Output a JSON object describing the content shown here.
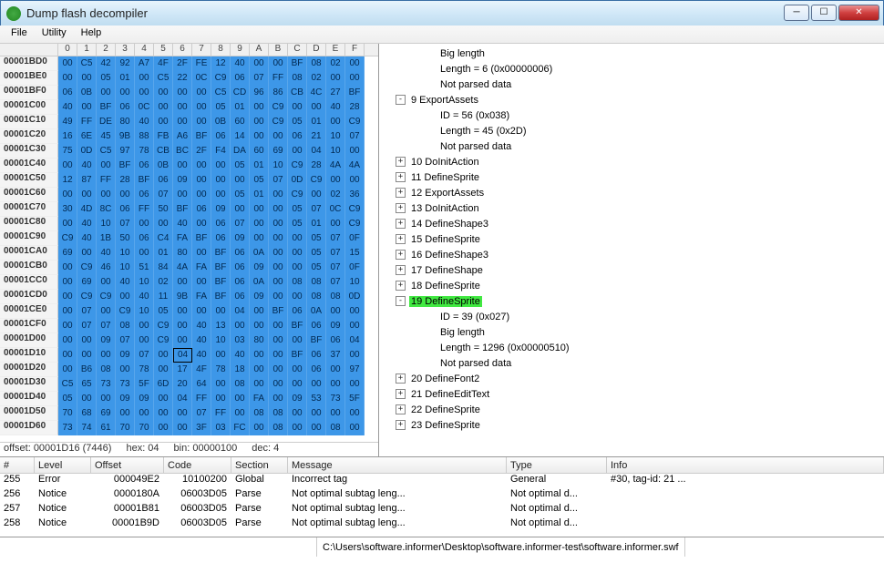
{
  "window": {
    "title": "Dump flash decompiler"
  },
  "menu": [
    "File",
    "Utility",
    "Help"
  ],
  "hex": {
    "cols": [
      "0",
      "1",
      "2",
      "3",
      "4",
      "5",
      "6",
      "7",
      "8",
      "9",
      "A",
      "B",
      "C",
      "D",
      "E",
      "F"
    ],
    "rows": [
      {
        "addr": "00001BD0",
        "b": [
          "00",
          "C5",
          "42",
          "92",
          "A7",
          "4F",
          "2F",
          "FE",
          "12",
          "40",
          "00",
          "00",
          "BF",
          "08",
          "02",
          "00"
        ]
      },
      {
        "addr": "00001BE0",
        "b": [
          "00",
          "00",
          "05",
          "01",
          "00",
          "C5",
          "22",
          "0C",
          "C9",
          "06",
          "07",
          "FF",
          "08",
          "02",
          "00",
          "00"
        ]
      },
      {
        "addr": "00001BF0",
        "b": [
          "06",
          "0B",
          "00",
          "00",
          "00",
          "00",
          "00",
          "00",
          "C5",
          "CD",
          "96",
          "86",
          "CB",
          "4C",
          "27",
          "BF"
        ]
      },
      {
        "addr": "00001C00",
        "b": [
          "40",
          "00",
          "BF",
          "06",
          "0C",
          "00",
          "00",
          "00",
          "05",
          "01",
          "00",
          "C9",
          "00",
          "00",
          "40",
          "28"
        ]
      },
      {
        "addr": "00001C10",
        "b": [
          "49",
          "FF",
          "DE",
          "80",
          "40",
          "00",
          "00",
          "00",
          "0B",
          "60",
          "00",
          "C9",
          "05",
          "01",
          "00",
          "C9"
        ]
      },
      {
        "addr": "00001C20",
        "b": [
          "16",
          "6E",
          "45",
          "9B",
          "88",
          "FB",
          "A6",
          "BF",
          "06",
          "14",
          "00",
          "00",
          "06",
          "21",
          "10",
          "07"
        ]
      },
      {
        "addr": "00001C30",
        "b": [
          "75",
          "0D",
          "C5",
          "97",
          "78",
          "CB",
          "BC",
          "2F",
          "F4",
          "DA",
          "60",
          "69",
          "00",
          "04",
          "10",
          "00"
        ]
      },
      {
        "addr": "00001C40",
        "b": [
          "00",
          "40",
          "00",
          "BF",
          "06",
          "0B",
          "00",
          "00",
          "00",
          "05",
          "01",
          "10",
          "C9",
          "28",
          "4A",
          "4A"
        ]
      },
      {
        "addr": "00001C50",
        "b": [
          "12",
          "87",
          "FF",
          "28",
          "BF",
          "06",
          "09",
          "00",
          "00",
          "00",
          "05",
          "07",
          "0D",
          "C9",
          "00",
          "00"
        ]
      },
      {
        "addr": "00001C60",
        "b": [
          "00",
          "00",
          "00",
          "00",
          "06",
          "07",
          "00",
          "00",
          "00",
          "05",
          "01",
          "00",
          "C9",
          "00",
          "02",
          "36"
        ]
      },
      {
        "addr": "00001C70",
        "b": [
          "30",
          "4D",
          "8C",
          "06",
          "FF",
          "50",
          "BF",
          "06",
          "09",
          "00",
          "00",
          "00",
          "05",
          "07",
          "0C",
          "C9"
        ]
      },
      {
        "addr": "00001C80",
        "b": [
          "00",
          "40",
          "10",
          "07",
          "00",
          "00",
          "40",
          "00",
          "06",
          "07",
          "00",
          "00",
          "05",
          "01",
          "00",
          "C9"
        ]
      },
      {
        "addr": "00001C90",
        "b": [
          "C9",
          "40",
          "1B",
          "50",
          "06",
          "C4",
          "FA",
          "BF",
          "06",
          "09",
          "00",
          "00",
          "00",
          "05",
          "07",
          "0F"
        ]
      },
      {
        "addr": "00001CA0",
        "b": [
          "69",
          "00",
          "40",
          "10",
          "00",
          "01",
          "80",
          "00",
          "BF",
          "06",
          "0A",
          "00",
          "00",
          "05",
          "07",
          "15"
        ]
      },
      {
        "addr": "00001CB0",
        "b": [
          "00",
          "C9",
          "46",
          "10",
          "51",
          "84",
          "4A",
          "FA",
          "BF",
          "06",
          "09",
          "00",
          "00",
          "05",
          "07",
          "0F"
        ]
      },
      {
        "addr": "00001CC0",
        "b": [
          "00",
          "69",
          "00",
          "40",
          "10",
          "02",
          "00",
          "00",
          "BF",
          "06",
          "0A",
          "00",
          "08",
          "08",
          "07",
          "10"
        ]
      },
      {
        "addr": "00001CD0",
        "b": [
          "00",
          "C9",
          "C9",
          "00",
          "40",
          "11",
          "9B",
          "FA",
          "BF",
          "06",
          "09",
          "00",
          "00",
          "08",
          "08",
          "0D"
        ]
      },
      {
        "addr": "00001CE0",
        "b": [
          "00",
          "07",
          "00",
          "C9",
          "10",
          "05",
          "00",
          "00",
          "00",
          "04",
          "00",
          "BF",
          "06",
          "0A",
          "00",
          "00"
        ]
      },
      {
        "addr": "00001CF0",
        "b": [
          "00",
          "07",
          "07",
          "08",
          "00",
          "C9",
          "00",
          "40",
          "13",
          "00",
          "00",
          "00",
          "BF",
          "06",
          "09",
          "00"
        ]
      },
      {
        "addr": "00001D00",
        "b": [
          "00",
          "00",
          "09",
          "07",
          "00",
          "C9",
          "00",
          "40",
          "10",
          "03",
          "80",
          "00",
          "00",
          "BF",
          "06",
          "04"
        ]
      },
      {
        "addr": "00001D10",
        "b": [
          "00",
          "00",
          "00",
          "09",
          "07",
          "00",
          "04",
          "40",
          "00",
          "40",
          "00",
          "00",
          "BF",
          "06",
          "37",
          "00"
        ],
        "sel": 6
      },
      {
        "addr": "00001D20",
        "b": [
          "00",
          "B6",
          "08",
          "00",
          "78",
          "00",
          "17",
          "4F",
          "78",
          "18",
          "00",
          "00",
          "00",
          "06",
          "00",
          "97"
        ]
      },
      {
        "addr": "00001D30",
        "b": [
          "C5",
          "65",
          "73",
          "73",
          "5F",
          "6D",
          "20",
          "64",
          "00",
          "08",
          "00",
          "00",
          "00",
          "00",
          "00",
          "00"
        ]
      },
      {
        "addr": "00001D40",
        "b": [
          "05",
          "00",
          "00",
          "09",
          "09",
          "00",
          "04",
          "FF",
          "00",
          "00",
          "FA",
          "00",
          "09",
          "53",
          "73",
          "5F"
        ]
      },
      {
        "addr": "00001D50",
        "b": [
          "70",
          "68",
          "69",
          "00",
          "00",
          "00",
          "00",
          "07",
          "FF",
          "00",
          "08",
          "08",
          "00",
          "00",
          "00",
          "00"
        ]
      },
      {
        "addr": "00001D60",
        "b": [
          "73",
          "74",
          "61",
          "70",
          "70",
          "00",
          "00",
          "3F",
          "03",
          "FC",
          "00",
          "08",
          "00",
          "00",
          "08",
          "00"
        ]
      }
    ],
    "status": {
      "offset": "offset: 00001D16 (7446)",
      "hex": "hex: 04",
      "bin": "bin: 00000100",
      "dec": "dec: 4"
    }
  },
  "tree": [
    {
      "depth": 3,
      "tog": "",
      "label": "Big length"
    },
    {
      "depth": 3,
      "tog": "",
      "label": "Length = 6 (0x00000006)"
    },
    {
      "depth": 3,
      "tog": "",
      "label": "Not parsed data"
    },
    {
      "depth": 1,
      "tog": "-",
      "label": "9 ExportAssets"
    },
    {
      "depth": 3,
      "tog": "",
      "label": "ID = 56 (0x038)"
    },
    {
      "depth": 3,
      "tog": "",
      "label": "Length = 45 (0x2D)"
    },
    {
      "depth": 3,
      "tog": "",
      "label": "Not parsed data"
    },
    {
      "depth": 1,
      "tog": "+",
      "label": "10 DoInitAction"
    },
    {
      "depth": 1,
      "tog": "+",
      "label": "11 DefineSprite"
    },
    {
      "depth": 1,
      "tog": "+",
      "label": "12 ExportAssets"
    },
    {
      "depth": 1,
      "tog": "+",
      "label": "13 DoInitAction"
    },
    {
      "depth": 1,
      "tog": "+",
      "label": "14 DefineShape3"
    },
    {
      "depth": 1,
      "tog": "+",
      "label": "15 DefineSprite"
    },
    {
      "depth": 1,
      "tog": "+",
      "label": "16 DefineShape3"
    },
    {
      "depth": 1,
      "tog": "+",
      "label": "17 DefineShape"
    },
    {
      "depth": 1,
      "tog": "+",
      "label": "18 DefineSprite"
    },
    {
      "depth": 1,
      "tog": "-",
      "label": "19 DefineSprite",
      "hl": true
    },
    {
      "depth": 3,
      "tog": "",
      "label": "ID = 39 (0x027)"
    },
    {
      "depth": 3,
      "tog": "",
      "label": "Big length"
    },
    {
      "depth": 3,
      "tog": "",
      "label": "Length = 1296 (0x00000510)"
    },
    {
      "depth": 3,
      "tog": "",
      "label": "Not parsed data"
    },
    {
      "depth": 1,
      "tog": "+",
      "label": "20 DefineFont2"
    },
    {
      "depth": 1,
      "tog": "+",
      "label": "21 DefineEditText"
    },
    {
      "depth": 1,
      "tog": "+",
      "label": "22 DefineSprite"
    },
    {
      "depth": 1,
      "tog": "+",
      "label": "23 DefineSprite"
    }
  ],
  "msg": {
    "headers": {
      "num": "#",
      "level": "Level",
      "offset": "Offset",
      "code": "Code",
      "section": "Section",
      "message": "Message",
      "type": "Type",
      "info": "Info"
    },
    "rows": [
      {
        "num": "255",
        "level": "Error",
        "offset": "000049E2",
        "code": "10100200",
        "section": "Global",
        "message": "Incorrect tag",
        "type": "General",
        "info": "#30, tag-id: 21 ..."
      },
      {
        "num": "256",
        "level": "Notice",
        "offset": "0000180A",
        "code": "06003D05",
        "section": "Parse",
        "message": "Not optimal subtag leng...",
        "type": "Not optimal d...",
        "info": ""
      },
      {
        "num": "257",
        "level": "Notice",
        "offset": "00001B81",
        "code": "06003D05",
        "section": "Parse",
        "message": "Not optimal subtag leng...",
        "type": "Not optimal d...",
        "info": ""
      },
      {
        "num": "258",
        "level": "Notice",
        "offset": "00001B9D",
        "code": "06003D05",
        "section": "Parse",
        "message": "Not optimal subtag leng...",
        "type": "Not optimal d...",
        "info": ""
      }
    ]
  },
  "status": {
    "path": "C:\\Users\\software.informer\\Desktop\\software.informer-test\\software.informer.swf"
  }
}
